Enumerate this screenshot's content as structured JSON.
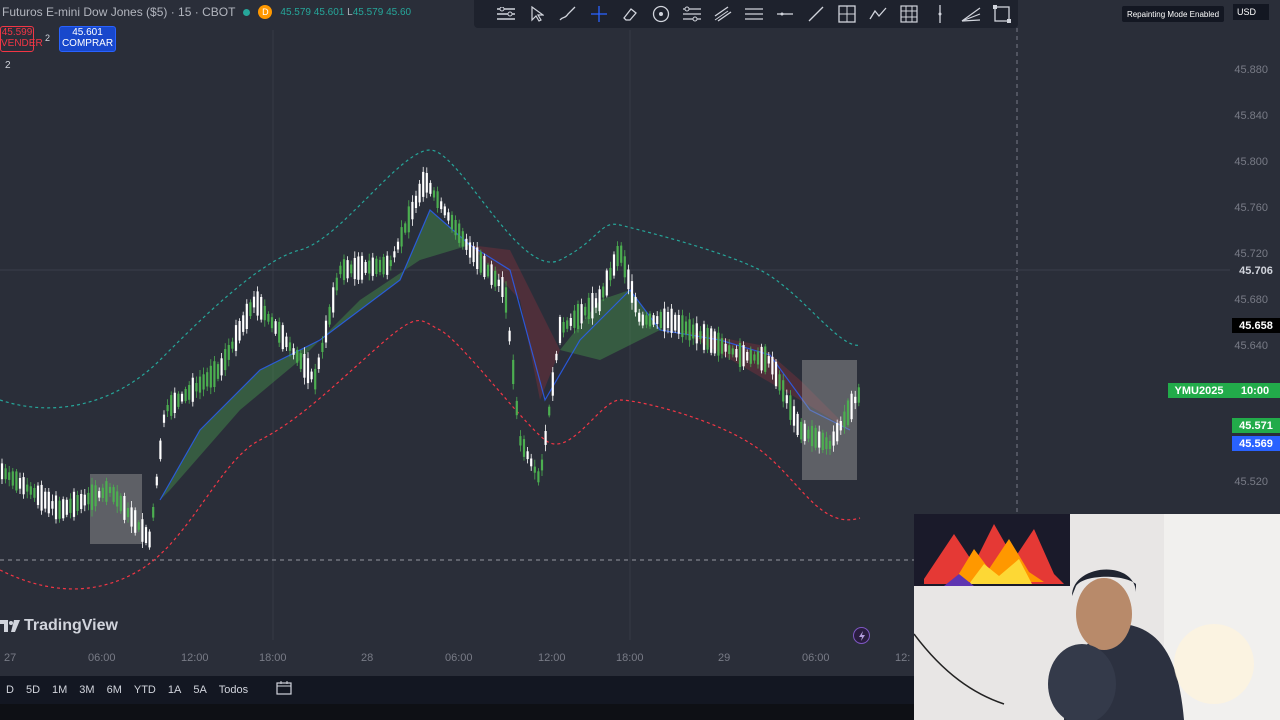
{
  "header": {
    "symbol_title": "Futuros E-mini Dow Jones ($5) · 15 · CBOT",
    "status_badge": "D",
    "ohlc": [
      {
        "label": "",
        "value": "45.579"
      },
      {
        "label": "",
        "value": "45.601"
      },
      {
        "label": "L",
        "value": "45.579"
      },
      {
        "label": "",
        "value": "45.60"
      }
    ]
  },
  "trade": {
    "sell_price": "45.599",
    "sell_label": "VENDER",
    "spread": "2",
    "buy_price": "45.601",
    "buy_label": "COMPRAR",
    "indicator_count": "2"
  },
  "toolbar": {
    "tools": [
      "settings-list-icon",
      "cursor-icon",
      "brush-icon",
      "crosshair-icon",
      "eraser-icon",
      "circle-target-icon",
      "layers-icon",
      "parallel-channel-icon",
      "hlines-icon",
      "horizontal-ray-icon",
      "trend-line-icon",
      "box-plus-icon",
      "pattern-icon",
      "grid-icon",
      "vertical-line-icon",
      "fib-fan-icon",
      "rectangle-icon"
    ]
  },
  "repaint_label": "Repainting Mode Enabled",
  "currency": "USD",
  "price_axis": [
    "45.880",
    "45.840",
    "45.800",
    "45.760",
    "45.720",
    "45.706",
    "45.680",
    "45.658",
    "45.640",
    "45.571",
    "45.569",
    "45.520"
  ],
  "price_highlights": {
    "current": "45.706",
    "crosshair": "45.658",
    "contract_name": "YMU2025",
    "countdown": "10:00",
    "last_green": "45.571",
    "last_blue": "45.569"
  },
  "time_axis": [
    "27",
    "06:00",
    "12:00",
    "18:00",
    "28",
    "06:00",
    "12:00",
    "18:00",
    "29",
    "06:00",
    "12:"
  ],
  "logo_text": "TradingView",
  "ranges": [
    "D",
    "5D",
    "1M",
    "3M",
    "6M",
    "YTD",
    "1A",
    "5A",
    "Todos"
  ],
  "colors": {
    "background": "#2a2e39",
    "up_candle": "#4caf50",
    "down_candle": "#ffffff",
    "upper_band": "#26a69a",
    "lower_band": "#f23645",
    "toolbar_bg": "#1e222d"
  }
}
